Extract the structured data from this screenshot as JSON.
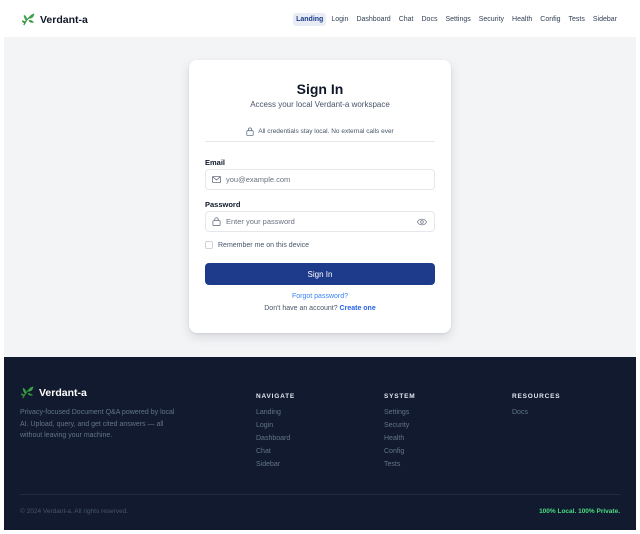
{
  "brand": {
    "name": "Verdant-a"
  },
  "nav": {
    "items": [
      "Landing",
      "Login",
      "Dashboard",
      "Chat",
      "Docs",
      "Settings",
      "Security",
      "Health",
      "Config",
      "Tests",
      "Sidebar"
    ],
    "active": "Landing"
  },
  "signin": {
    "title": "Sign In",
    "subtitle": "Access your local Verdant-a workspace",
    "notice": "All credentials stay local. No external calls ever",
    "email_label": "Email",
    "email_placeholder": "you@example.com",
    "email_value": "",
    "password_label": "Password",
    "password_placeholder": "Enter your password",
    "password_value": "",
    "remember_label": "Remember me on this device",
    "remember_checked": false,
    "button_label": "Sign In",
    "forgot_label": "Forgot password?",
    "signup_prompt": "Don't have an account?",
    "signup_link": "Create one"
  },
  "footer": {
    "brand": "Verdant-a",
    "description": "Privacy-focused Document Q&A powered by local AI. Upload, query, and get cited answers — all without leaving your machine.",
    "columns": [
      {
        "heading": "NAVIGATE",
        "links": [
          "Landing",
          "Login",
          "Dashboard",
          "Chat",
          "Sidebar"
        ]
      },
      {
        "heading": "SYSTEM",
        "links": [
          "Settings",
          "Security",
          "Health",
          "Config",
          "Tests"
        ]
      },
      {
        "heading": "RESOURCES",
        "links": [
          "Docs"
        ]
      }
    ],
    "copyright": "© 2024 Verdant-a. All rights reserved.",
    "tagline": "100% Local. 100% Private."
  },
  "colors": {
    "accent": "#1e3a8a",
    "link": "#2563eb",
    "footer_bg": "#111a2e",
    "tagline": "#4ade80",
    "leaf": "#2f8f3a"
  },
  "icons": {
    "brand": "leaf-icon",
    "notice": "lock-icon",
    "email": "mail-icon",
    "password": "lock-icon",
    "toggle": "eye-icon"
  }
}
